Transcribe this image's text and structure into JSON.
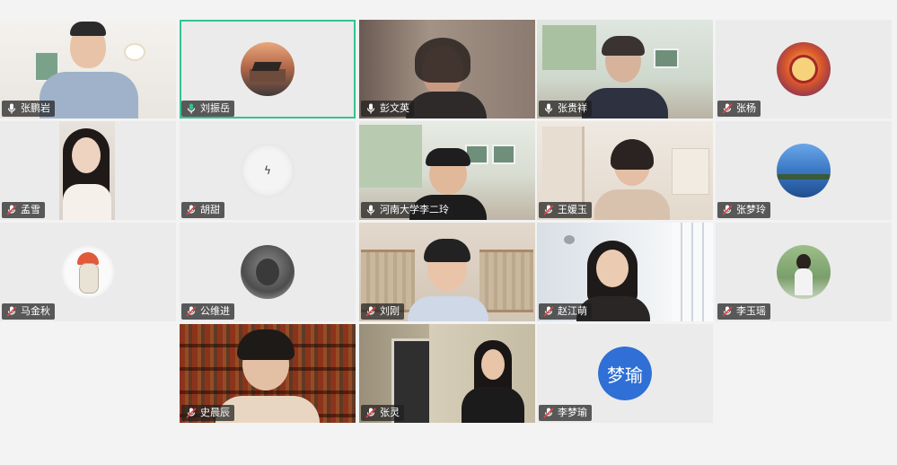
{
  "colors": {
    "background": "#f3f3f3",
    "tile_bg": "#ebebeb",
    "active_outline": "#34c38f",
    "muted_mic": "#e04545",
    "active_mic": "#34c38f",
    "avatar_blue": "#2f6fd6"
  },
  "participants": [
    {
      "name": "张鹏岩",
      "mic": "mic-on-icon"
    },
    {
      "name": "刘振岳",
      "mic": "mic-speaking-icon"
    },
    {
      "name": "彭文英",
      "mic": "mic-on-icon"
    },
    {
      "name": "张贵祥",
      "mic": "mic-on-icon"
    },
    {
      "name": "张杨",
      "mic": "mic-muted-icon"
    },
    {
      "name": "孟雪",
      "mic": "mic-muted-icon"
    },
    {
      "name": "胡甜",
      "mic": "mic-muted-icon"
    },
    {
      "name": "河南大学李二玲",
      "mic": "mic-on-icon"
    },
    {
      "name": "王媛玉",
      "mic": "mic-muted-icon"
    },
    {
      "name": "张梦玲",
      "mic": "mic-muted-icon"
    },
    {
      "name": "马金秋",
      "mic": "mic-muted-icon"
    },
    {
      "name": "公维进",
      "mic": "mic-muted-icon"
    },
    {
      "name": "刘刚",
      "mic": "mic-muted-icon"
    },
    {
      "name": "赵江萌",
      "mic": "mic-muted-icon"
    },
    {
      "name": "李玉瑶",
      "mic": "mic-muted-icon"
    },
    {
      "name": "史晨辰",
      "mic": "mic-muted-icon"
    },
    {
      "name": "张灵",
      "mic": "mic-muted-icon"
    },
    {
      "name": "李梦瑜",
      "mic": "mic-muted-icon",
      "avatar_text": "梦瑜"
    }
  ]
}
